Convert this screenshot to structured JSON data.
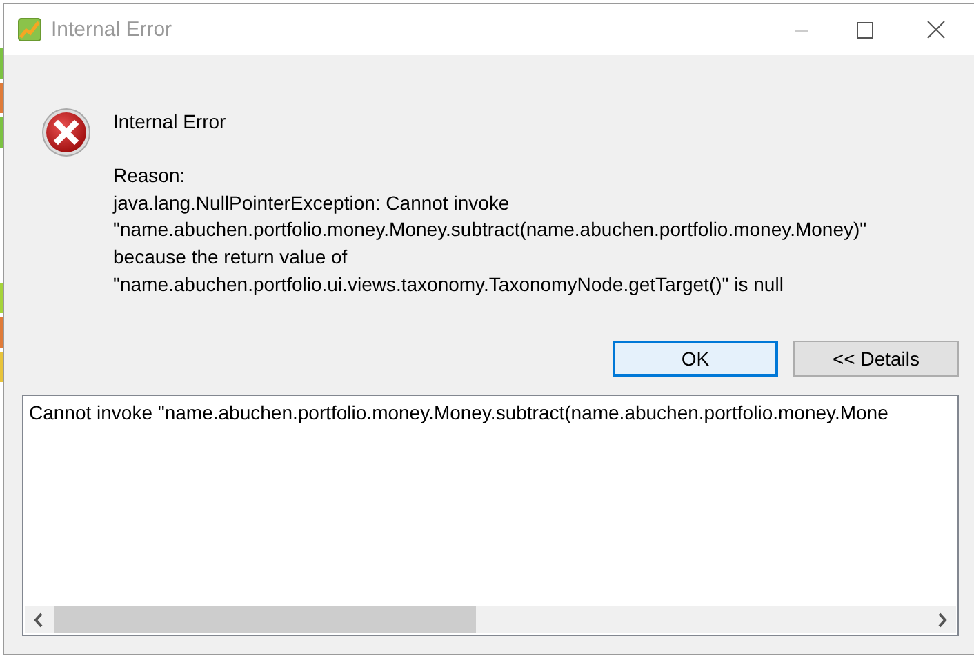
{
  "window": {
    "title": "Internal Error",
    "active": false
  },
  "message": {
    "heading": "Internal Error",
    "reason_label": "Reason:",
    "lines": [
      "java.lang.NullPointerException: Cannot invoke",
      "\"name.abuchen.portfolio.money.Money.subtract(name.abuchen.portfolio.money.Money)\"",
      "because the return value of",
      "\"name.abuchen.portfolio.ui.views.taxonomy.TaxonomyNode.getTarget()\" is null"
    ]
  },
  "buttons": [
    {
      "label": "OK",
      "default": true
    },
    {
      "label": "<< Details",
      "default": false
    }
  ],
  "details": {
    "text": "Cannot invoke \"name.abuchen.portfolio.money.Money.subtract(name.abuchen.portfolio.money.Mone"
  }
}
